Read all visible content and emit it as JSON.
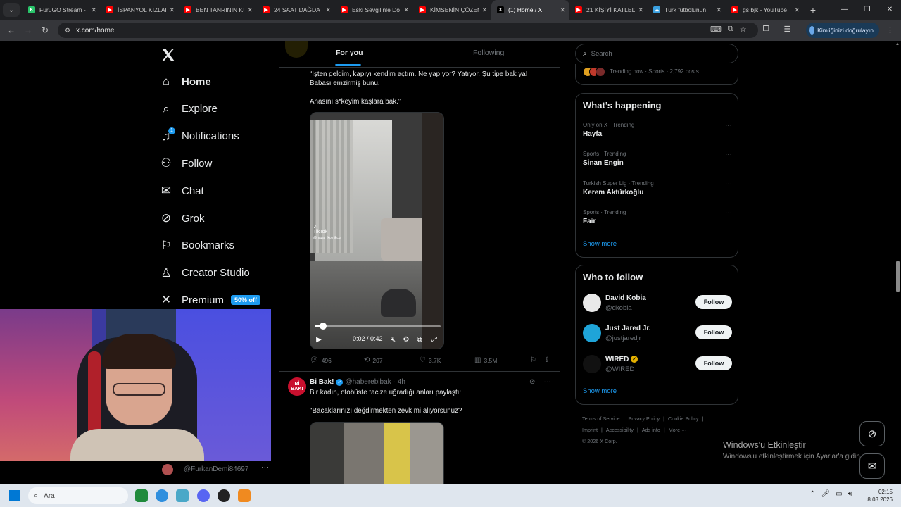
{
  "browser": {
    "tabs": [
      {
        "title": "FuruGO Stream -",
        "favicon_color": "#29c46a",
        "favicon_glyph": "K",
        "active": false
      },
      {
        "title": "İSPANYOL KIZLAR",
        "favicon_color": "#ff0000",
        "favicon_glyph": "▶",
        "active": false
      },
      {
        "title": "BEN TANRININ KU",
        "favicon_color": "#ff0000",
        "favicon_glyph": "▶",
        "active": false
      },
      {
        "title": "24 SAAT DAĞDA",
        "favicon_color": "#ff0000",
        "favicon_glyph": "▶",
        "active": false
      },
      {
        "title": "Eski Sevgilinle Do",
        "favicon_color": "#ff0000",
        "favicon_glyph": "▶",
        "active": false
      },
      {
        "title": "KİMSENİN ÇÖZEM",
        "favicon_color": "#ff0000",
        "favicon_glyph": "▶",
        "active": false
      },
      {
        "title": "(1) Home / X",
        "favicon_color": "#000000",
        "favicon_glyph": "X",
        "active": true
      },
      {
        "title": "21 KİŞİYİ KATLEDE",
        "favicon_color": "#ff0000",
        "favicon_glyph": "▶",
        "active": false
      },
      {
        "title": "Türk futbolunun",
        "favicon_color": "#3aa0e0",
        "favicon_glyph": "☁",
        "active": false
      },
      {
        "title": "gs bjk - YouTube",
        "favicon_color": "#ff0000",
        "favicon_glyph": "▶",
        "active": false
      }
    ],
    "url": "x.com/home",
    "profile_label": "Kimliğinizi doğrulayın"
  },
  "nav": {
    "items": [
      {
        "label": "Home",
        "icon": "home-icon",
        "bold": true
      },
      {
        "label": "Explore",
        "icon": "search-icon",
        "bold": false
      },
      {
        "label": "Notifications",
        "icon": "bell-icon",
        "bold": false,
        "badge": "1"
      },
      {
        "label": "Follow",
        "icon": "person-plus-icon",
        "bold": false
      },
      {
        "label": "Chat",
        "icon": "mail-icon",
        "bold": false
      },
      {
        "label": "Grok",
        "icon": "grok-icon",
        "bold": false
      },
      {
        "label": "Bookmarks",
        "icon": "bookmark-icon",
        "bold": false
      },
      {
        "label": "Creator Studio",
        "icon": "creator-icon",
        "bold": false
      },
      {
        "label": "Premium",
        "icon": "x-icon",
        "bold": false
      }
    ],
    "premium_badge": "50% off"
  },
  "timeline": {
    "tabs": [
      "For you",
      "Following"
    ],
    "active_tab": "For you",
    "tweet1": {
      "text_line1": "“İşten geldim, kapıyı kendim açtım. Ne yapıyor? Yatıyor. Şu tipe bak ya!",
      "text_line2": "Babası emzirmiş bunu.",
      "text_line3": "Anasını s*keyim kaşlara bak.”",
      "video": {
        "watermark": "TikTok",
        "watermark_handle": "@hazar_komikcu",
        "time": "0:02 / 0:42",
        "progress": 0.05
      },
      "actions": {
        "replies": "496",
        "reposts": "207",
        "likes": "3.7K",
        "views": "3.5M"
      }
    },
    "tweet2": {
      "avatar_text": "Bİ BAK!",
      "name": "Bi Bak!",
      "handle": "@haberebibak",
      "time": "· 4h",
      "text_line1": "Bir kadın, otobüste tacize uğradığı anları paylaştı:",
      "text_line2": "\"Bacaklarınızı değdirmekten zevk mi alıyorsunuz?"
    }
  },
  "sidebar": {
    "search_placeholder": "Search",
    "trending_now": "Trending now · Sports · 2,792 posts",
    "whats_happening": {
      "title": "What’s happening",
      "trends": [
        {
          "meta": "Only on X · Trending",
          "topic": "Hayfa"
        },
        {
          "meta": "Sports · Trending",
          "topic": "Sinan Engin"
        },
        {
          "meta": "Turkish Super Lig · Trending",
          "topic": "Kerem Aktürkoğlu"
        },
        {
          "meta": "Sports · Trending",
          "topic": "Fair"
        }
      ],
      "show_more": "Show more"
    },
    "who_to_follow": {
      "title": "Who to follow",
      "accounts": [
        {
          "name": "David Kobia",
          "handle": "@dkobia",
          "verified": false,
          "avatar_color": "#e9e9e9"
        },
        {
          "name": "Just Jared Jr.",
          "handle": "@justjaredjr",
          "verified": false,
          "avatar_color": "#1fa4d8"
        },
        {
          "name": "WIRED",
          "handle": "@WIRED",
          "verified": true,
          "avatar_color": "#111111"
        }
      ],
      "follow_label": "Follow",
      "show_more": "Show more"
    },
    "footer": {
      "links_row1": [
        "Terms of Service",
        "|",
        "Privacy Policy",
        "|",
        "Cookie Policy",
        "|"
      ],
      "links_row2": [
        "Imprint",
        "|",
        "Accessibility",
        "|",
        "Ads info",
        "|",
        "More ···"
      ],
      "copyright": "© 2026 X Corp."
    }
  },
  "watermark": {
    "line1": "Windows'u Etkinleştir",
    "line2": "Windows'u etkinleştirmek için Ayarlar'a gidin."
  },
  "webcam": {
    "handle": "@FurkanDemi84697"
  },
  "taskbar": {
    "search_placeholder": "Ara",
    "time": "02:15",
    "date": "8.03.2026"
  }
}
